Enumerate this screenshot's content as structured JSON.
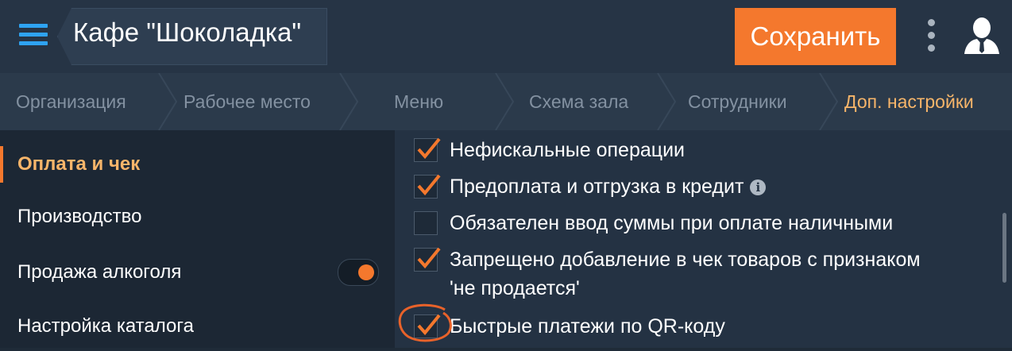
{
  "header": {
    "title": "Кафе \"Шоколадка\"",
    "save_label": "Сохранить",
    "menu_icon": "hamburger-menu-icon",
    "more_icon": "kebab-menu-icon",
    "user_icon": "user-avatar-icon"
  },
  "tabs": [
    {
      "label": "Организация",
      "active": false
    },
    {
      "label": "Рабочее место",
      "active": false
    },
    {
      "label": "Меню",
      "active": false
    },
    {
      "label": "Схема зала",
      "active": false
    },
    {
      "label": "Сотрудники",
      "active": false
    },
    {
      "label": "Доп. настройки",
      "active": true
    }
  ],
  "sidebar": {
    "items": [
      {
        "label": "Оплата и чек",
        "active": true
      },
      {
        "label": "Производство",
        "active": false
      },
      {
        "label": "Продажа алкоголя",
        "active": false,
        "toggle_on": true
      },
      {
        "label": "Настройка каталога",
        "active": false
      }
    ]
  },
  "options": [
    {
      "label": "Нефискальные операции",
      "checked": true
    },
    {
      "label": "Предоплата и отгрузка в кредит",
      "checked": true,
      "info": true
    },
    {
      "label": "Обязателен ввод суммы при оплате наличными",
      "checked": false
    },
    {
      "label": "Запрещено добавление в чек товаров с признаком",
      "label2": "'не продается'",
      "checked": true
    },
    {
      "label": "Быстрые платежи по QR-коду",
      "checked": true,
      "highlighted": true
    }
  ],
  "colors": {
    "accent": "#f4782d",
    "active_text": "#f7b56a",
    "menu_icon": "#2ea3f2",
    "header_bg": "#263445",
    "content_bg": "#243243"
  }
}
